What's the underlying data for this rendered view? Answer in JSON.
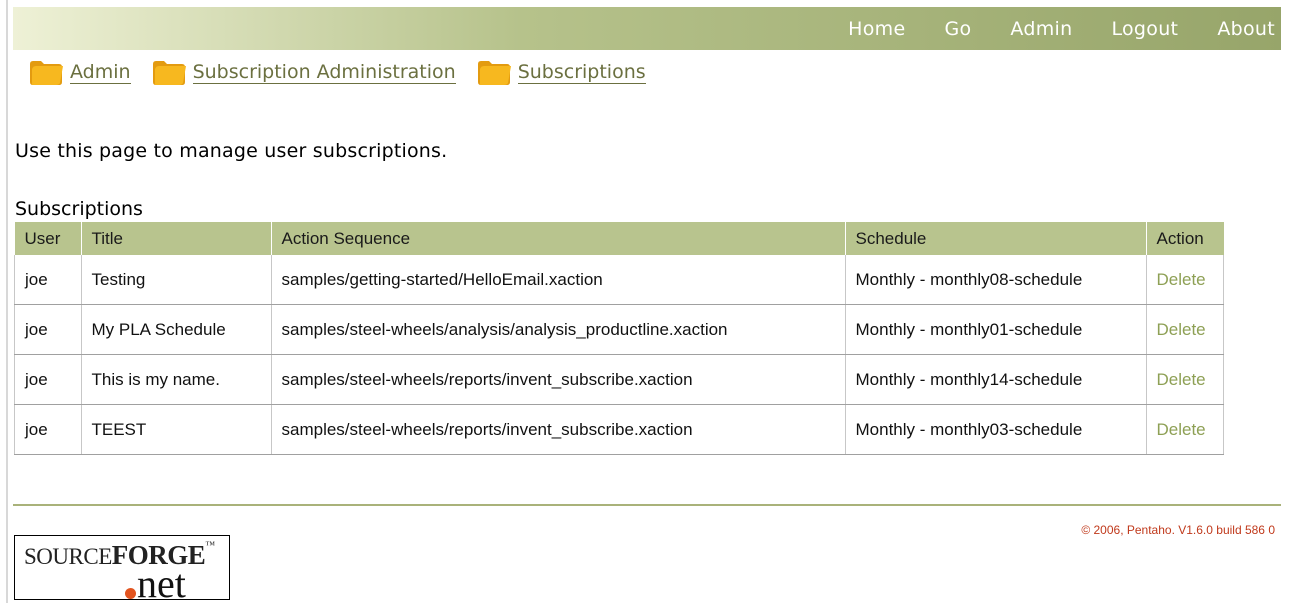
{
  "topnav": {
    "items": [
      "Home",
      "Go",
      "Admin",
      "Logout",
      "About"
    ]
  },
  "breadcrumb": [
    {
      "label": "Admin"
    },
    {
      "label": "Subscription Administration"
    },
    {
      "label": "Subscriptions"
    }
  ],
  "intro_text": "Use this page to manage user subscriptions.",
  "table": {
    "caption": "Subscriptions",
    "headers": [
      "User",
      "Title",
      "Action Sequence",
      "Schedule",
      "Action"
    ],
    "rows": [
      {
        "user": "joe",
        "title": "Testing",
        "action_sequence": "samples/getting-started/HelloEmail.xaction",
        "schedule": "Monthly - monthly08-schedule",
        "action": "Delete"
      },
      {
        "user": "joe",
        "title": "My PLA Schedule",
        "action_sequence": "samples/steel-wheels/analysis/analysis_productline.xaction",
        "schedule": "Monthly - monthly01-schedule",
        "action": "Delete"
      },
      {
        "user": "joe",
        "title": "This is my name.",
        "action_sequence": "samples/steel-wheels/reports/invent_subscribe.xaction",
        "schedule": "Monthly - monthly14-schedule",
        "action": "Delete"
      },
      {
        "user": "joe",
        "title": "TEEST",
        "action_sequence": "samples/steel-wheels/reports/invent_subscribe.xaction",
        "schedule": "Monthly - monthly03-schedule",
        "action": "Delete"
      }
    ]
  },
  "footer": {
    "copyright": "© 2006, Pentaho. V1.6.0 build 586 0",
    "logo_text_1": "SOURCE",
    "logo_text_2": "FORGE",
    "logo_net": "net"
  },
  "colors": {
    "header_green": "#97a56a",
    "link_olive": "#6b7040",
    "delete_green": "#8ea055",
    "copyright_red": "#c0391b"
  },
  "icons": [
    "folder-icon"
  ]
}
